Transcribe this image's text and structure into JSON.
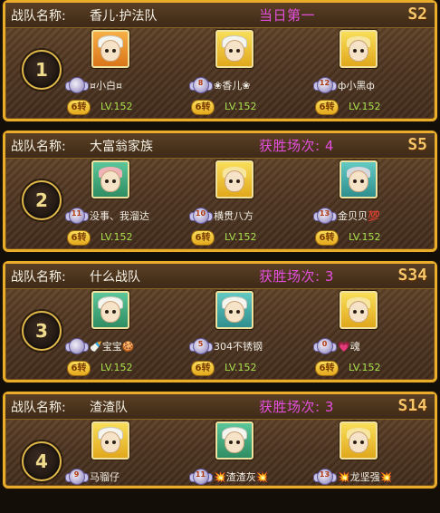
{
  "team_label": "战队名称:",
  "teams": [
    {
      "name": "香儿·护法队",
      "status": "当日第一",
      "server": "S2",
      "rank": "1",
      "members": [
        {
          "vip": "",
          "name": "¤小白¤",
          "coin": "6转",
          "level": "LV.152",
          "avatar": "orange",
          "hair": "white"
        },
        {
          "vip": "8",
          "name": "❀香儿❀",
          "coin": "6转",
          "level": "LV.152",
          "avatar": "yellow",
          "hair": "white"
        },
        {
          "vip": "12",
          "name": "ф小黑ф",
          "coin": "6转",
          "level": "LV.152",
          "avatar": "yellow",
          "hair": "blond"
        }
      ]
    },
    {
      "name": "大富翁家族",
      "status": "获胜场次: 4",
      "server": "S5",
      "rank": "2",
      "members": [
        {
          "vip": "11",
          "name": "没事、我溜达",
          "coin": "6转",
          "level": "LV.152",
          "avatar": "green",
          "hair": "pink"
        },
        {
          "vip": "10",
          "name": "横贯八方",
          "coin": "6转",
          "level": "LV.152",
          "avatar": "yellow",
          "hair": "blond"
        },
        {
          "vip": "13",
          "name": "金贝贝💯",
          "coin": "6转",
          "level": "LV.152",
          "avatar": "teal",
          "hair": "gray"
        }
      ]
    },
    {
      "name": "什么战队",
      "status": "获胜场次: 3",
      "server": "S34",
      "rank": "3",
      "members": [
        {
          "vip": "",
          "name": "🍼宝宝🍪",
          "coin": "6转",
          "level": "LV.152",
          "avatar": "green",
          "hair": "white"
        },
        {
          "vip": "5",
          "name": "304不锈钢",
          "coin": "6转",
          "level": "LV.152",
          "avatar": "teal",
          "hair": "white"
        },
        {
          "vip": "0",
          "name": "💗魂",
          "coin": "6转",
          "level": "LV.152",
          "avatar": "yellow",
          "hair": "blond"
        }
      ]
    },
    {
      "name": "渣渣队",
      "status": "获胜场次: 3",
      "server": "S14",
      "rank": "4",
      "members": [
        {
          "vip": "9",
          "name": "马骝仔",
          "coin": "",
          "level": "",
          "avatar": "yellow",
          "hair": "white"
        },
        {
          "vip": "11",
          "name": "💥渣渣灰💥",
          "coin": "",
          "level": "",
          "avatar": "green",
          "hair": "white"
        },
        {
          "vip": "13",
          "name": "💥龙坚强💥",
          "coin": "",
          "level": "",
          "avatar": "yellow",
          "hair": "blond"
        }
      ]
    }
  ]
}
